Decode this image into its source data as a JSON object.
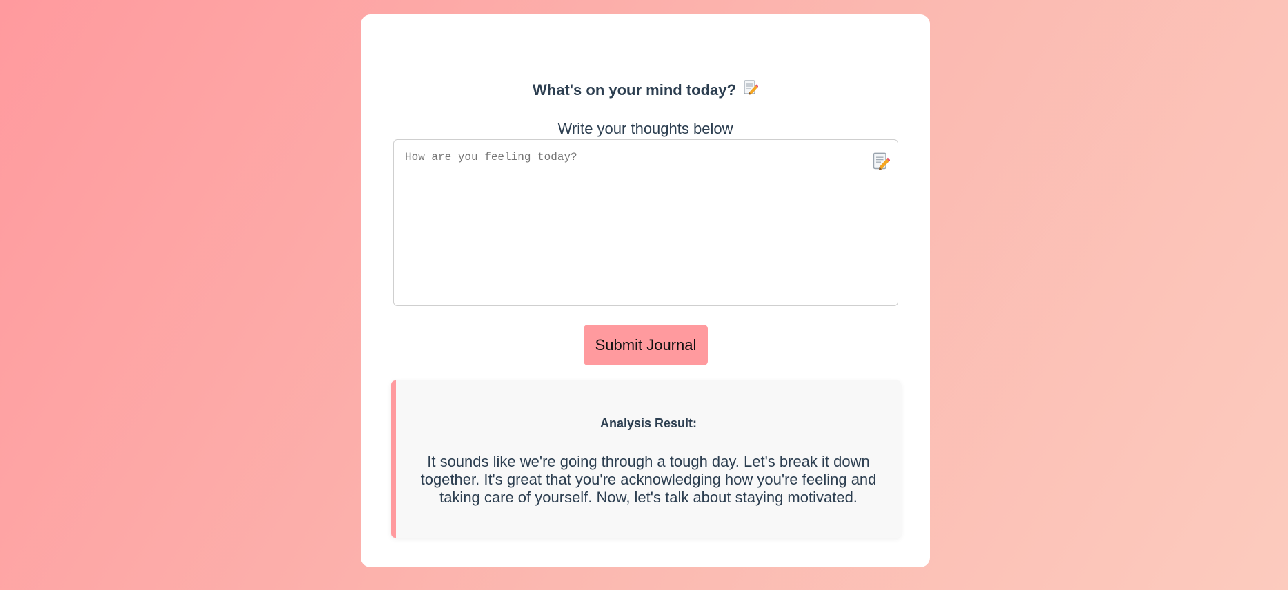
{
  "journal": {
    "heading": "What's on your mind today?",
    "heading_icon": "memo-icon",
    "subheading": "Write your thoughts below",
    "textarea": {
      "placeholder": "How are you feeling today?",
      "value": "",
      "icon": "memo-icon"
    },
    "submit_label": "Submit Journal"
  },
  "result": {
    "title": "Analysis Result:",
    "text": "It sounds like we're going through a tough day. Let's break it down together. It's great that you're acknowledging how you're feeling and taking care of yourself. Now, let's talk about staying motivated."
  },
  "colors": {
    "accent": "#ff9a9e",
    "text": "#2c3e50",
    "card": "#ffffff",
    "result_bg": "#f8f8f8"
  }
}
